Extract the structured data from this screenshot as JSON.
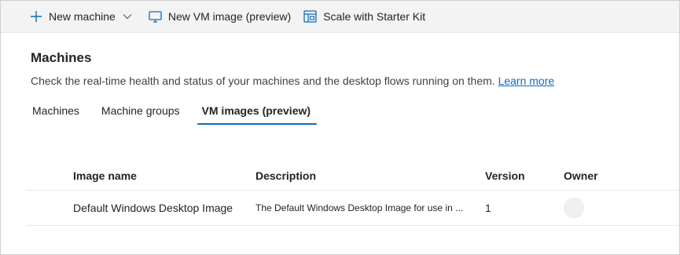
{
  "toolbar": {
    "new_machine": "New machine",
    "new_vm_image": "New VM image (preview)",
    "scale_starter_kit": "Scale with Starter Kit"
  },
  "page": {
    "title": "Machines",
    "subtitle": "Check the real-time health and status of your machines and the desktop flows running on them.",
    "learn_more": "Learn more"
  },
  "tabs": [
    {
      "label": "Machines",
      "active": false
    },
    {
      "label": "Machine groups",
      "active": false
    },
    {
      "label": "VM images (preview)",
      "active": true
    }
  ],
  "table": {
    "headers": [
      "Image name",
      "Description",
      "Version",
      "Owner"
    ],
    "rows": [
      {
        "image_name": "Default Windows Desktop Image",
        "description": "The Default Windows Desktop Image for use in ...",
        "version": "1",
        "owner": ""
      }
    ]
  },
  "colors": {
    "accent": "#0f6cbd",
    "toolbar_bg": "#f3f3f3"
  },
  "icons": [
    "plus-icon",
    "chevron-down-icon",
    "monitor-icon",
    "starter-kit-icon"
  ]
}
